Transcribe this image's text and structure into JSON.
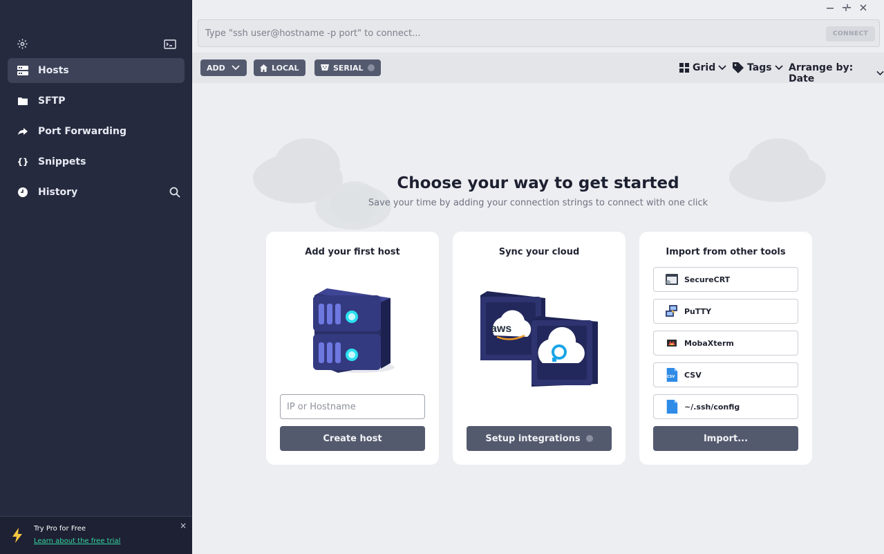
{
  "sidebar": {
    "items": [
      {
        "label": "Hosts",
        "icon": "hosts-icon",
        "active": true
      },
      {
        "label": "SFTP",
        "icon": "folder-icon"
      },
      {
        "label": "Port Forwarding",
        "icon": "port-forward-icon"
      },
      {
        "label": "Snippets",
        "icon": "braces-icon",
        "glyph": "{}"
      },
      {
        "label": "History",
        "icon": "clock-icon"
      }
    ],
    "promo": {
      "title": "Try Pro for Free",
      "link": "Learn about the free trial",
      "close": "×"
    }
  },
  "address_bar": {
    "placeholder": "Type \"ssh user@hostname -p port\" to connect...",
    "connect_label": "CONNECT"
  },
  "toolbar": {
    "add_label": "ADD",
    "local_label": "LOCAL",
    "serial_label": "SERIAL",
    "view_label": "Grid",
    "tags_label": "Tags",
    "arrange_label": "Arrange by: Date"
  },
  "hero": {
    "title": "Choose your way to get started",
    "subtitle": "Save your time by adding your connection strings to connect with one click"
  },
  "cards": {
    "host": {
      "title": "Add your first host",
      "input_placeholder": "IP or Hostname",
      "button": "Create host"
    },
    "cloud": {
      "title": "Sync your cloud",
      "aws_label": "aws",
      "button": "Setup integrations"
    },
    "import": {
      "title": "Import from other tools",
      "items": [
        {
          "label": "SecureCRT",
          "icon": "securecrt-icon"
        },
        {
          "label": "PuTTY",
          "icon": "putty-icon"
        },
        {
          "label": "MobaXterm",
          "icon": "mobaxterm-icon"
        },
        {
          "label": "CSV",
          "icon": "csv-file-icon",
          "badge": "CSV"
        },
        {
          "label": "~/.ssh/config",
          "icon": "config-file-icon"
        }
      ],
      "button": "Import..."
    }
  },
  "colors": {
    "sidebar_bg": "#262a3f",
    "accent_green": "#35d6a2",
    "button_bg": "#545a6e",
    "bolt_yellow": "#f4c542"
  }
}
